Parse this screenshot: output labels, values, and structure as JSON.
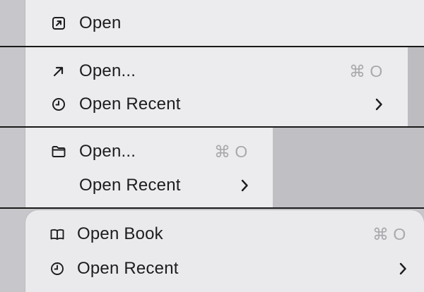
{
  "menus": [
    {
      "items": [
        {
          "icon": "open-square-arrow-icon",
          "label": "Open"
        }
      ]
    },
    {
      "items": [
        {
          "icon": "arrow-up-right-icon",
          "label": "Open...",
          "shortcut": "⌘ O"
        },
        {
          "icon": "clock-icon",
          "label": "Open Recent",
          "submenu": true
        }
      ]
    },
    {
      "items": [
        {
          "icon": "folder-icon",
          "label": "Open...",
          "shortcut": "⌘ O"
        },
        {
          "label": "Open Recent",
          "submenu": true
        }
      ]
    },
    {
      "items": [
        {
          "icon": "book-icon",
          "label": "Open Book",
          "shortcut": "⌘ O"
        },
        {
          "icon": "clock-icon",
          "label": "Open Recent",
          "submenu": true
        }
      ]
    }
  ],
  "colors": {
    "menu_bg": "#ececee",
    "backdrop": "#c7c7cb",
    "text": "#1d1d1f",
    "shortcut": "#a9a9ad"
  }
}
